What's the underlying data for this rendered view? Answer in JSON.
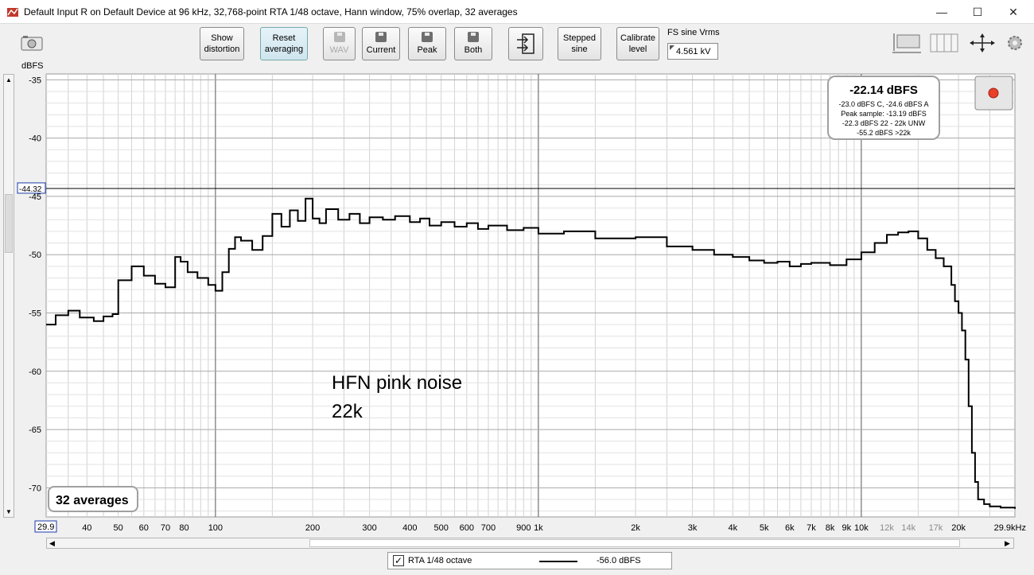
{
  "window": {
    "title": "Default Input R on Default Device at 96 kHz, 32,768-point RTA 1/48 octave, Hann window, 75% overlap, 32 averages",
    "minimize": "—",
    "maximize": "☐",
    "close": "✕"
  },
  "toolbar": {
    "show_distortion": [
      "Show",
      "distortion"
    ],
    "reset_averaging": [
      "Reset",
      "averaging"
    ],
    "wav": "WAV",
    "current": "Current",
    "peak": "Peak",
    "both": "Both",
    "stepped_sine": [
      "Stepped",
      "sine"
    ],
    "calibrate_level": [
      "Calibrate",
      "level"
    ],
    "fs_sine_label": "FS sine Vrms",
    "fs_sine_value": "4.561 kV"
  },
  "plot": {
    "y_unit": "dBFS",
    "cursor_value": "-44.32",
    "x_start_label": "29.9",
    "averages_badge": "32 averages",
    "readout": {
      "main": "-22.14 dBFS",
      "lines": [
        "-23.0 dBFS C, -24.6 dBFS A",
        "Peak sample: -13.19 dBFS",
        "-22.3 dBFS 22 - 22k UNW",
        "-55.2 dBFS >22k"
      ]
    },
    "annotation": [
      "HFN pink noise",
      "22k"
    ]
  },
  "legend": {
    "checked": "✓",
    "name": "RTA 1/48 octave",
    "level": "-56.0 dBFS"
  },
  "chart_data": {
    "type": "line",
    "xscale": "log",
    "xlim": [
      29.9,
      29900
    ],
    "ylim": [
      -72.5,
      -34.5
    ],
    "grid": true,
    "y_ticks": [
      -35,
      -40,
      -45,
      -50,
      -55,
      -60,
      -65,
      -70
    ],
    "y_tick_labels": [
      "-35",
      "-40",
      "-45",
      "-50",
      "-55",
      "-60",
      "-65",
      "-70"
    ],
    "x_ticks": [
      40,
      50,
      60,
      70,
      80,
      100,
      200,
      300,
      400,
      500,
      600,
      700,
      900,
      1000,
      2000,
      3000,
      4000,
      5000,
      6000,
      7000,
      8000,
      9000,
      10000,
      12000,
      14000,
      17000,
      20000,
      29900
    ],
    "x_tick_labels": [
      "40",
      "50",
      "60",
      "70",
      "80",
      "100",
      "200",
      "300",
      "400",
      "500",
      "600",
      "700",
      "900",
      "1k",
      "2k",
      "3k",
      "4k",
      "5k",
      "6k",
      "7k",
      "8k",
      "9k",
      "10k",
      "12k",
      "14k",
      "17k",
      "20k",
      "29.9kHz"
    ],
    "cursor_level": -44.32,
    "series": [
      {
        "name": "RTA 1/48 octave",
        "color": "#000000",
        "x": [
          29.9,
          32,
          35,
          38,
          42,
          45,
          48,
          50,
          55,
          60,
          65,
          70,
          75,
          78,
          82,
          88,
          95,
          100,
          105,
          110,
          115,
          120,
          130,
          140,
          150,
          160,
          170,
          180,
          190,
          200,
          210,
          220,
          240,
          260,
          280,
          300,
          330,
          360,
          400,
          430,
          460,
          500,
          550,
          600,
          650,
          700,
          800,
          900,
          1000,
          1200,
          1500,
          2000,
          2500,
          3000,
          3500,
          4000,
          4500,
          5000,
          5500,
          6000,
          6500,
          7000,
          8000,
          9000,
          10000,
          11000,
          12000,
          13000,
          14000,
          15000,
          16000,
          17000,
          18000,
          19000,
          19500,
          20000,
          20500,
          21000,
          21500,
          22000,
          22500,
          23000,
          24000,
          25000,
          27000,
          29900
        ],
        "y": [
          -56.0,
          -55.2,
          -54.8,
          -55.4,
          -55.7,
          -55.3,
          -55.1,
          -52.2,
          -51.0,
          -51.8,
          -52.5,
          -52.8,
          -50.2,
          -50.6,
          -51.5,
          -52.0,
          -52.6,
          -53.1,
          -51.5,
          -49.5,
          -48.5,
          -48.8,
          -49.6,
          -48.4,
          -46.5,
          -47.6,
          -46.2,
          -47.1,
          -45.2,
          -46.9,
          -47.3,
          -46.1,
          -47.0,
          -46.5,
          -47.3,
          -46.8,
          -47.0,
          -46.7,
          -47.2,
          -46.9,
          -47.5,
          -47.2,
          -47.6,
          -47.3,
          -47.8,
          -47.5,
          -47.9,
          -47.7,
          -48.2,
          -48.0,
          -48.6,
          -48.5,
          -49.3,
          -49.6,
          -50.0,
          -50.2,
          -50.5,
          -50.7,
          -50.6,
          -51.0,
          -50.8,
          -50.7,
          -50.9,
          -50.4,
          -49.8,
          -49.0,
          -48.3,
          -48.1,
          -48.0,
          -48.6,
          -49.6,
          -50.3,
          -51.0,
          -52.6,
          -54.0,
          -55.0,
          -56.5,
          -59.0,
          -63.0,
          -67.0,
          -69.5,
          -71.0,
          -71.4,
          -71.6,
          -71.7,
          -71.8
        ]
      }
    ]
  }
}
